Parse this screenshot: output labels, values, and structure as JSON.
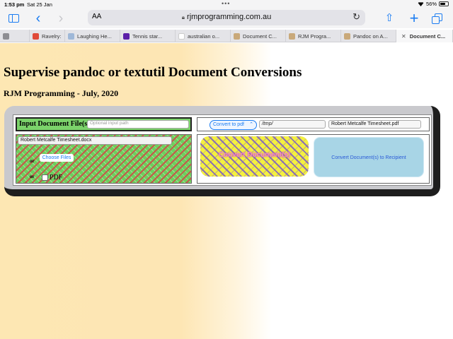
{
  "status_bar": {
    "time": "1:53 pm",
    "date": "Sat 25 Jan",
    "multitask_dots": "•••",
    "battery": "56%"
  },
  "browser": {
    "aa_label": "AA",
    "url": "rjmprogramming.com.au",
    "tabs": [
      {
        "label": "",
        "favicon": "#8e8e93",
        "active": false
      },
      {
        "label": "Ravelry:",
        "favicon": "#e04b3a",
        "active": false
      },
      {
        "label": "Laughing He...",
        "favicon": "#9fb8d8",
        "active": false
      },
      {
        "label": "Tennis star...",
        "favicon": "#5b1fa8",
        "active": false
      },
      {
        "label": "australian o...",
        "favicon": "#ffffff",
        "active": false
      },
      {
        "label": "Document C...",
        "favicon": "#c9a97a",
        "active": false
      },
      {
        "label": "RJM Progra...",
        "favicon": "#c9a97a",
        "active": false
      },
      {
        "label": "Pandoc on A...",
        "favicon": "#c9a97a",
        "active": false
      },
      {
        "label": "Document C...",
        "favicon": "",
        "active": true
      }
    ]
  },
  "page": {
    "title": "Supervise pandoc or textutil Document Conversions",
    "subtitle": "RJM Programming - July, 2020",
    "input_label": "Input Document File(s)",
    "input_path_placeholder": "Optional input path",
    "convert_select": "Convert to pdf",
    "tmp_path": "/tmp/",
    "output_file": "Robert Metcalfe Timesheet.pdf",
    "input_file": "Robert Metcalfe Timesheet.docx",
    "or_label_1": "or",
    "choose_files_label": "Choose Files",
    "or_label_2": "or",
    "pdf_label": "PDF",
    "convert_documents_label": "Convert Document(s)",
    "convert_recipient_label": "Convert Document(s) to Recipient"
  }
}
